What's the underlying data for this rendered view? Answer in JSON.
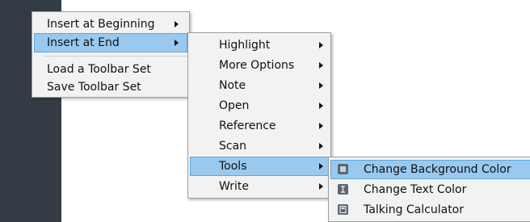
{
  "menu_main": {
    "items": [
      {
        "label": "Insert at Beginning",
        "has_submenu": true,
        "selected": false
      },
      {
        "label": "Insert at End",
        "has_submenu": true,
        "selected": true
      },
      {
        "label": "Load a Toolbar Set",
        "has_submenu": false,
        "selected": false
      },
      {
        "label": "Save Toolbar Set",
        "has_submenu": false,
        "selected": false
      }
    ]
  },
  "menu_insert_at_end": {
    "items": [
      {
        "label": "Highlight"
      },
      {
        "label": "More Options"
      },
      {
        "label": "Note"
      },
      {
        "label": "Open"
      },
      {
        "label": "Reference"
      },
      {
        "label": "Scan"
      },
      {
        "label": "Tools",
        "selected": true
      },
      {
        "label": "Write"
      }
    ]
  },
  "menu_tools": {
    "items": [
      {
        "label": "Change Background Color",
        "icon": "background-color-icon",
        "selected": true
      },
      {
        "label": "Change Text Color",
        "icon": "text-color-icon",
        "selected": false
      },
      {
        "label": "Talking Calculator",
        "icon": "calculator-icon",
        "selected": false
      }
    ]
  },
  "colors": {
    "highlight": "#99c9ef",
    "highlight_border": "#5fa7dd",
    "menu_bg": "#f2f2f2",
    "toolbar_bg": "#333c44"
  }
}
